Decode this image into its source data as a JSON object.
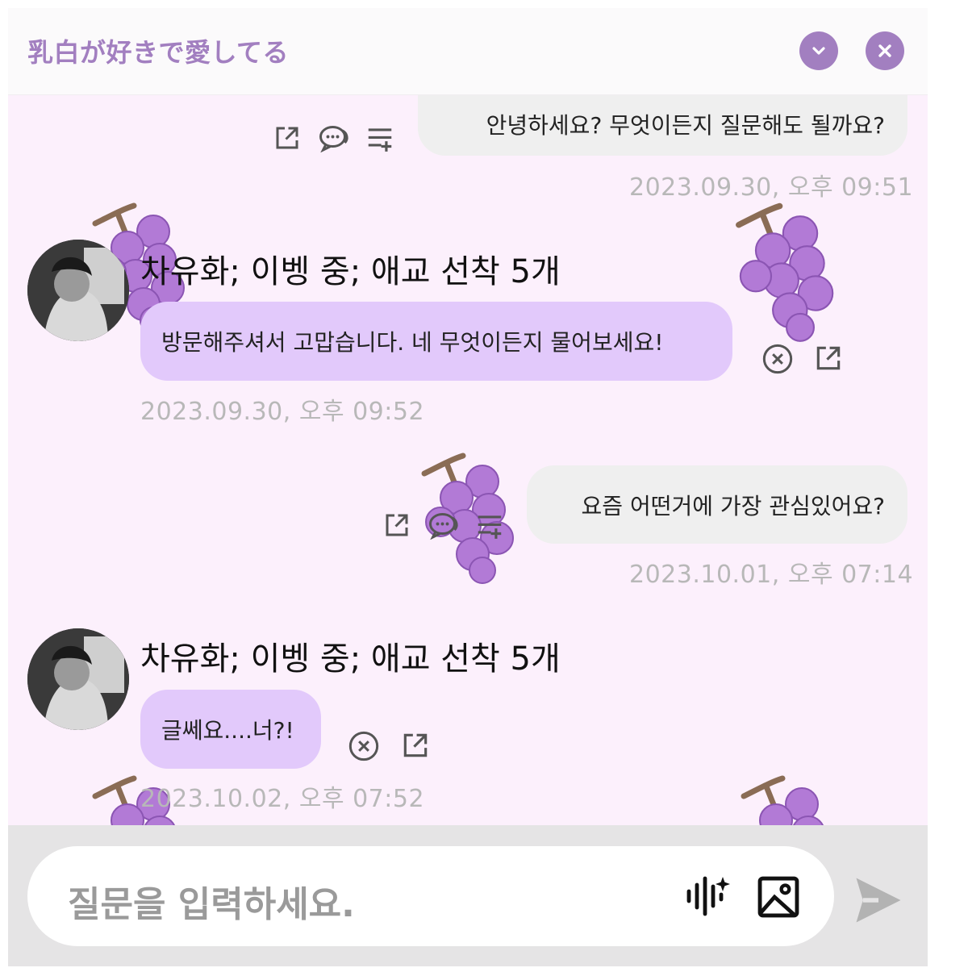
{
  "header": {
    "title": "乳白が好きで愛してる",
    "minimize_icon": "chevron-down-icon",
    "close_icon": "close-icon"
  },
  "messages": [
    {
      "role": "user",
      "text": "안녕하세요? 무엇이든지 질문해도 될까요?",
      "timestamp": "2023.09.30, 오후 09:51"
    },
    {
      "role": "bot",
      "name": "차유화; 이벵 중; 애교 선착 5개",
      "text": "방문해주셔서 고맙습니다. 네 무엇이든지 물어보세요!",
      "timestamp": "2023.09.30, 오후 09:52"
    },
    {
      "role": "user",
      "text": "요즘 어떤거에 가장 관심있어요?",
      "timestamp": "2023.10.01, 오후 07:14"
    },
    {
      "role": "bot",
      "name": "차유화; 이벵 중; 애교 선착 5개",
      "text": "글쎄요....너?!",
      "timestamp": "2023.10.02, 오후 07:52"
    }
  ],
  "input": {
    "placeholder": "질문을 입력하세요."
  },
  "colors": {
    "accent": "#a27fc0",
    "chat_bg": "#fcf0fc",
    "bot_bubble": "#e2c9fb",
    "user_bubble": "#efefef"
  }
}
